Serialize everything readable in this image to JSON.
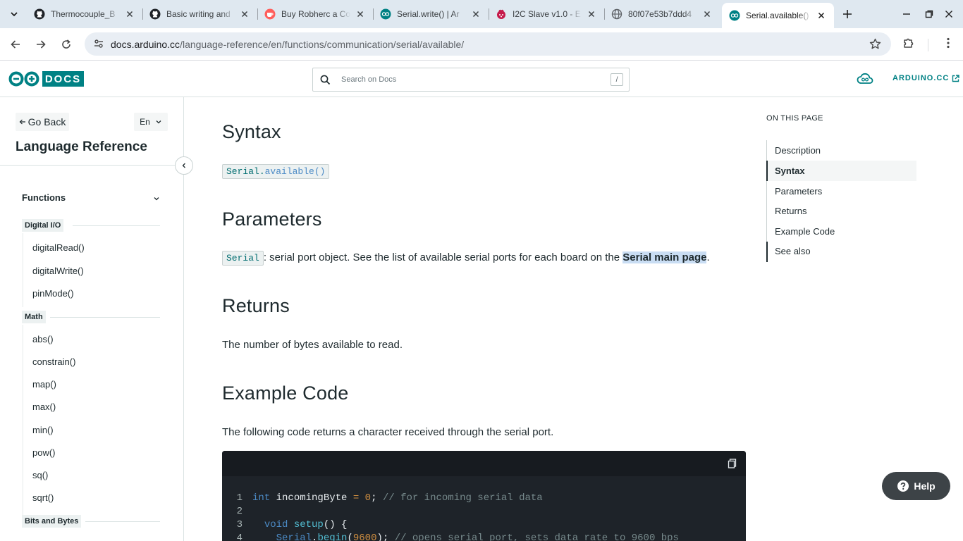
{
  "browser": {
    "tabs": [
      {
        "title": "Thermocouple_B",
        "icon": "github-icon"
      },
      {
        "title": "Basic writing and",
        "icon": "github-icon"
      },
      {
        "title": "Buy Robherc a Co",
        "icon": "coffee-icon"
      },
      {
        "title": "Serial.write() | Ar",
        "icon": "arduino-icon"
      },
      {
        "title": "I2C Slave v1.0 - E",
        "icon": "raspberry-icon"
      },
      {
        "title": "80f07e53b7ddd4",
        "icon": "globe-icon"
      },
      {
        "title": "Serial.available()",
        "icon": "arduino-icon",
        "active": true
      }
    ],
    "url_host": "docs.arduino.cc",
    "url_path": "/language-reference/en/functions/communication/serial/available/"
  },
  "header": {
    "logo_text": "DOCS",
    "search_placeholder": "Search on Docs",
    "search_shortcut": "/",
    "site_link": "ARDUINO.CC"
  },
  "sidebar": {
    "go_back": "Go Back",
    "language": "En",
    "title": "Language Reference",
    "section": "Functions",
    "categories": [
      {
        "label": "Digital I/O",
        "items": [
          "digitalRead()",
          "digitalWrite()",
          "pinMode()"
        ]
      },
      {
        "label": "Math",
        "items": [
          "abs()",
          "constrain()",
          "map()",
          "max()",
          "min()",
          "pow()",
          "sq()",
          "sqrt()"
        ]
      },
      {
        "label": "Bits and Bytes",
        "items": []
      }
    ]
  },
  "content": {
    "syntax_heading": "Syntax",
    "syntax_obj": "Serial",
    "syntax_dot": ".",
    "syntax_fn": "available()",
    "params_heading": "Parameters",
    "param_name": "Serial",
    "param_text": ": serial port object. See the list of available serial ports for each board on the ",
    "param_link": "Serial main page",
    "param_end": ".",
    "returns_heading": "Returns",
    "returns_text": "The number of bytes available to read.",
    "example_heading": "Example Code",
    "example_text": "The following code returns a character received through the serial port.",
    "code": {
      "l1": {
        "num": "1",
        "kw": "int",
        "id": " incomingByte ",
        "op": "=",
        "sp": " ",
        "val": "0",
        "semi": "; ",
        "cm": "// for incoming serial data"
      },
      "l2": {
        "num": "2"
      },
      "l3": {
        "num": "3",
        "indent": "  ",
        "kw": "void",
        "fn": " setup",
        "rest": "() {"
      },
      "l4": {
        "num": "4",
        "indent": "    ",
        "obj": "Serial",
        "dot": ".",
        "fn": "begin",
        "open": "(",
        "val": "9600",
        "close": "); ",
        "cm": "// opens serial port, sets data rate to 9600 bps"
      }
    }
  },
  "toc": {
    "title": "ON THIS PAGE",
    "items": [
      "Description",
      "Syntax",
      "Parameters",
      "Returns",
      "Example Code",
      "See also"
    ],
    "active": "Syntax"
  },
  "help_label": "Help",
  "colors": {
    "brand": "#008184",
    "code_bg": "#1e2329",
    "highlight": "#c9ddf3"
  }
}
